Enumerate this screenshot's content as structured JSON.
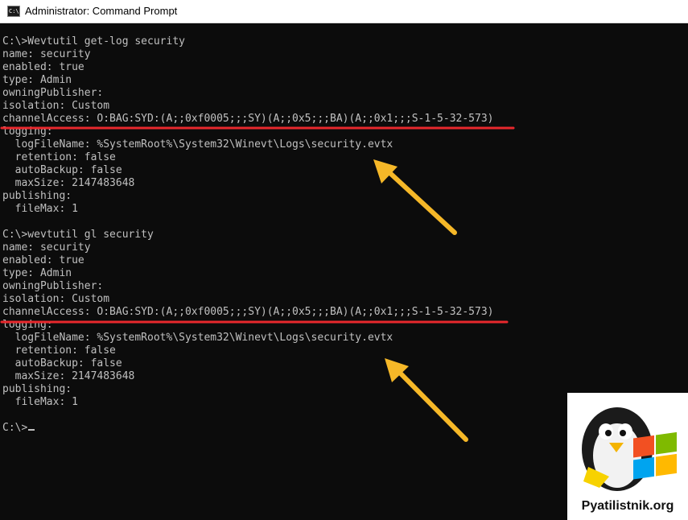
{
  "window": {
    "title": "Administrator: Command Prompt",
    "icon": "cmd-icon"
  },
  "console": {
    "lines": [
      "C:\\>Wevtutil get-log security",
      "name: security",
      "enabled: true",
      "type: Admin",
      "owningPublisher:",
      "isolation: Custom",
      "channelAccess: O:BAG:SYD:(A;;0xf0005;;;SY)(A;;0x5;;;BA)(A;;0x1;;;S-1-5-32-573)",
      "logging:",
      "  logFileName: %SystemRoot%\\System32\\Winevt\\Logs\\security.evtx",
      "  retention: false",
      "  autoBackup: false",
      "  maxSize: 2147483648",
      "publishing:",
      "  fileMax: 1",
      "",
      "C:\\>wevtutil gl security",
      "name: security",
      "enabled: true",
      "type: Admin",
      "owningPublisher:",
      "isolation: Custom",
      "channelAccess: O:BAG:SYD:(A;;0xf0005;;;SY)(A;;0x5;;;BA)(A;;0x1;;;S-1-5-32-573)",
      "logging:",
      "  logFileName: %SystemRoot%\\System32\\Winevt\\Logs\\security.evtx",
      "  retention: false",
      "  autoBackup: false",
      "  maxSize: 2147483648",
      "publishing:",
      "  fileMax: 1",
      "",
      "C:\\>"
    ]
  },
  "annotations": {
    "underline_color": "#e8282d",
    "arrow_color": "#f6b828"
  },
  "watermark": {
    "text": "Pyatilistnik.org"
  }
}
